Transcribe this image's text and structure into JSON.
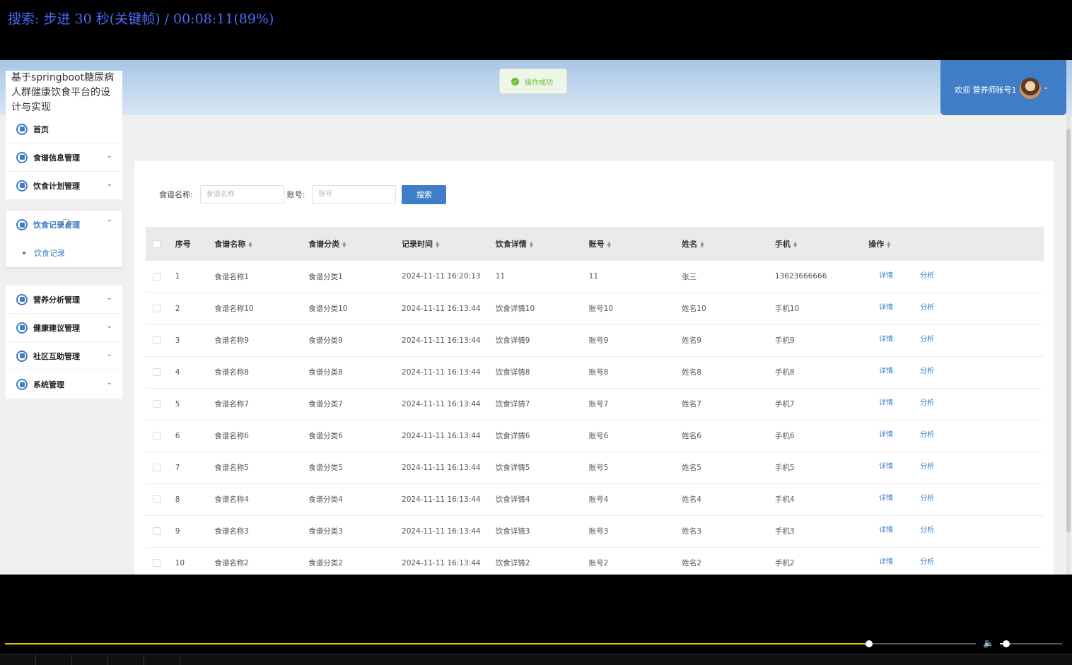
{
  "player": {
    "osd_text": "搜索: 步进 30 秒(关键帧) / 00:08:11(89%)",
    "progress_fraction": 0.89,
    "volume_fraction": 0.1
  },
  "header": {
    "brand_title": "基于springboot糖尿病人群健康饮食平台的设计与实现",
    "toast": "操作成功",
    "welcome": "欢迎 营养师账号1"
  },
  "sidebar": {
    "home": "首页",
    "items": [
      {
        "label": "食谱信息管理",
        "icon": "recipe-icon"
      },
      {
        "label": "饮食计划管理",
        "icon": "plan-icon"
      },
      {
        "label": "饮食记录管理",
        "icon": "record-icon",
        "expanded": true,
        "children": [
          "饮食记录"
        ]
      },
      {
        "label": "营养分析管理",
        "icon": "analysis-icon"
      },
      {
        "label": "健康建议管理",
        "icon": "advice-icon"
      },
      {
        "label": "社区互助管理",
        "icon": "community-icon"
      },
      {
        "label": "系统管理",
        "icon": "system-icon"
      }
    ]
  },
  "search": {
    "recipe_label": "食谱名称:",
    "recipe_placeholder": "食谱名称",
    "account_label": "账号:",
    "account_placeholder": "账号",
    "button": "搜索"
  },
  "table": {
    "columns": [
      "序号",
      "食谱名称",
      "食谱分类",
      "记录时间",
      "饮食详情",
      "账号",
      "姓名",
      "手机",
      "操作"
    ],
    "actions": {
      "detail": "详情",
      "analyze": "分析"
    },
    "rows": [
      {
        "no": "1",
        "recipe": "食谱名称1",
        "category": "食谱分类1",
        "time": "2024-11-11 16:20:13",
        "detail": "11",
        "account": "11",
        "name": "张三",
        "phone": "13623666666"
      },
      {
        "no": "2",
        "recipe": "食谱名称10",
        "category": "食谱分类10",
        "time": "2024-11-11 16:13:44",
        "detail": "饮食详情10",
        "account": "账号10",
        "name": "姓名10",
        "phone": "手机10"
      },
      {
        "no": "3",
        "recipe": "食谱名称9",
        "category": "食谱分类9",
        "time": "2024-11-11 16:13:44",
        "detail": "饮食详情9",
        "account": "账号9",
        "name": "姓名9",
        "phone": "手机9"
      },
      {
        "no": "4",
        "recipe": "食谱名称8",
        "category": "食谱分类8",
        "time": "2024-11-11 16:13:44",
        "detail": "饮食详情8",
        "account": "账号8",
        "name": "姓名8",
        "phone": "手机8"
      },
      {
        "no": "5",
        "recipe": "食谱名称7",
        "category": "食谱分类7",
        "time": "2024-11-11 16:13:44",
        "detail": "饮食详情7",
        "account": "账号7",
        "name": "姓名7",
        "phone": "手机7"
      },
      {
        "no": "6",
        "recipe": "食谱名称6",
        "category": "食谱分类6",
        "time": "2024-11-11 16:13:44",
        "detail": "饮食详情6",
        "account": "账号6",
        "name": "姓名6",
        "phone": "手机6"
      },
      {
        "no": "7",
        "recipe": "食谱名称5",
        "category": "食谱分类5",
        "time": "2024-11-11 16:13:44",
        "detail": "饮食详情5",
        "account": "账号5",
        "name": "姓名5",
        "phone": "手机5"
      },
      {
        "no": "8",
        "recipe": "食谱名称4",
        "category": "食谱分类4",
        "time": "2024-11-11 16:13:44",
        "detail": "饮食详情4",
        "account": "账号4",
        "name": "姓名4",
        "phone": "手机4"
      },
      {
        "no": "9",
        "recipe": "食谱名称3",
        "category": "食谱分类3",
        "time": "2024-11-11 16:13:44",
        "detail": "饮食详情3",
        "account": "账号3",
        "name": "姓名3",
        "phone": "手机3"
      },
      {
        "no": "10",
        "recipe": "食谱名称2",
        "category": "食谱分类2",
        "time": "2024-11-11 16:13:44",
        "detail": "饮食详情2",
        "account": "账号2",
        "name": "姓名2",
        "phone": "手机2"
      }
    ]
  },
  "colors": {
    "primary": "#3f7ec6",
    "success": "#67c23a",
    "osd": "#4d6bff",
    "progress": "#e0c400"
  }
}
